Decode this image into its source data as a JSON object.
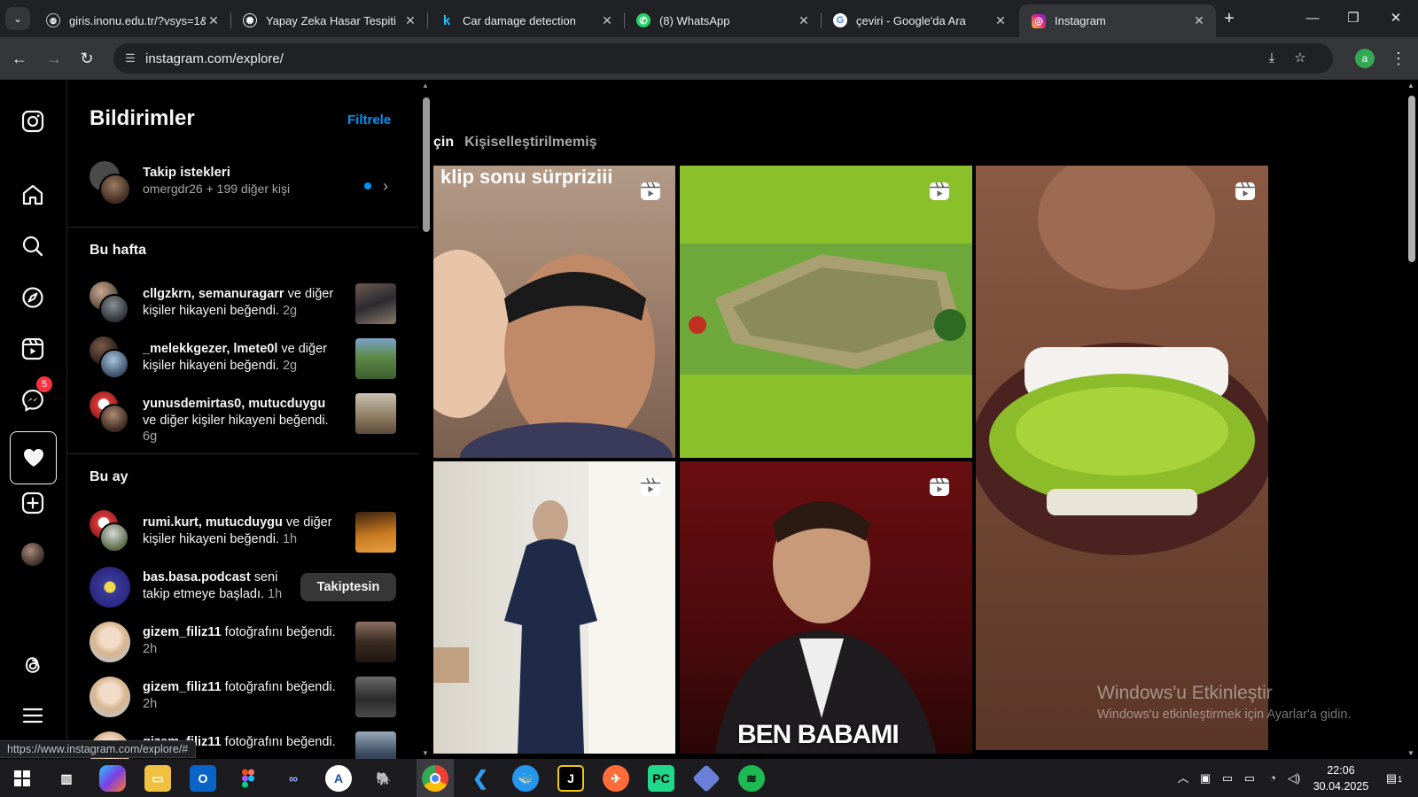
{
  "browser": {
    "tabs": [
      {
        "title": "giris.inonu.edu.tr/?vsys=1&",
        "active": false
      },
      {
        "title": "Yapay Zeka Hasar Tespiti",
        "active": false
      },
      {
        "title": "Car damage detection",
        "active": false
      },
      {
        "title": "(8) WhatsApp",
        "active": false
      },
      {
        "title": "çeviri - Google'da Ara",
        "active": false
      },
      {
        "title": "Instagram",
        "active": true
      }
    ],
    "url": "instagram.com/explore/",
    "profile_initial": "a",
    "status_url": "https://www.instagram.com/explore/#"
  },
  "instagram": {
    "nav": {
      "messages_badge": "5"
    },
    "notifications": {
      "title": "Bildirimler",
      "filter_label": "Filtrele",
      "follow_requests": {
        "title": "Takip istekleri",
        "subtitle": "omergdr26 + 199 diğer kişi"
      },
      "section_week": "Bu hafta",
      "section_month": "Bu ay",
      "week_items": [
        {
          "users": "cllgzkrn, semanuragarr",
          "text": " ve diğer kişiler hikayeni beğendi.",
          "time": " 2g"
        },
        {
          "users": "_melekkgezer, lmete0l",
          "text": " ve diğer kişiler hikayeni beğendi.",
          "time": " 2g"
        },
        {
          "users": "yunusdemirtas0, mutucduygu",
          "text": " ve diğer kişiler hikayeni beğendi.",
          "time": " 6g"
        }
      ],
      "month_items": [
        {
          "users": "rumi.kurt, mutucduygu",
          "text": " ve diğer kişiler hikayeni beğendi.",
          "time": " 1h"
        },
        {
          "users": "bas.basa.podcast",
          "text": " seni takip etmeye başladı.",
          "time": " 1h",
          "button": "Takiptesin"
        },
        {
          "users": "gizem_filiz11",
          "text": " fotoğrafını beğendi.",
          "time": " 2h"
        },
        {
          "users": "gizem_filiz11",
          "text": " fotoğrafını beğendi.",
          "time": " 2h"
        },
        {
          "users": "gizem_filiz11",
          "text": " fotoğrafını beğendi.",
          "time": ""
        }
      ]
    },
    "explore": {
      "tab_active_partial": "çin",
      "tab_inactive": "Kişiselleştirilmemiş",
      "tile1_caption": "klip sonu sürpriziii",
      "tile5_caption": "BEN BABAMI"
    }
  },
  "windows": {
    "activation_title": "Windows'u Etkinleştir",
    "activation_text": "Windows'u etkinleştirmek için Ayarlar'a gidin.",
    "time": "22:06",
    "date": "30.04.2025",
    "notification_count": "1"
  }
}
